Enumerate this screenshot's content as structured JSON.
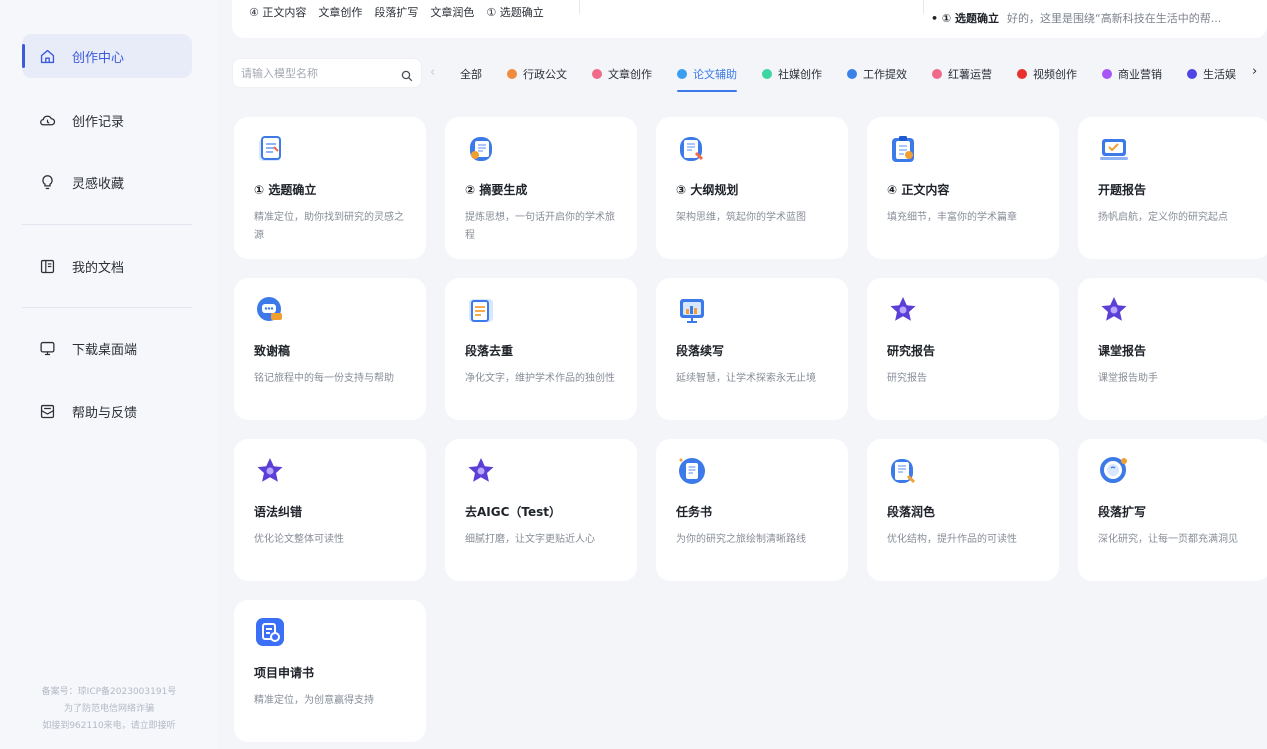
{
  "sidebar": {
    "items": [
      {
        "label": "创作中心",
        "icon": "home-icon",
        "active": true
      },
      {
        "label": "创作记录",
        "icon": "cloud-history-icon"
      },
      {
        "label": "灵感收藏",
        "icon": "lightbulb-icon"
      },
      {
        "label": "我的文档",
        "icon": "document-book-icon"
      },
      {
        "label": "下载桌面端",
        "icon": "monitor-icon"
      },
      {
        "label": "帮助与反馈",
        "icon": "feedback-mail-icon"
      }
    ],
    "footer": [
      "备案号：琼ICP备2023003191号",
      "为了防范电信网络诈骗",
      "如接到962110来电，请立即接听"
    ]
  },
  "top": {
    "recent": [
      "④ 正文内容",
      "文章创作",
      "段落扩写",
      "文章润色",
      "① 选题确立"
    ],
    "notice_title": "• ① 选题确立",
    "notice_text": "好的，这里是围绕“高新科技在生活中的帮..."
  },
  "search": {
    "placeholder": "请输入模型名称"
  },
  "categories": [
    {
      "label": "全部",
      "color": ""
    },
    {
      "label": "行政公文",
      "color": "#f08a3c"
    },
    {
      "label": "文章创作",
      "color": "#f06b8a"
    },
    {
      "label": "论文辅助",
      "color": "#3b9ef0",
      "active": true
    },
    {
      "label": "社媒创作",
      "color": "#3dd6a0"
    },
    {
      "label": "工作提效",
      "color": "#3b82e8"
    },
    {
      "label": "红薯运营",
      "color": "#f06b8a"
    },
    {
      "label": "视频创作",
      "color": "#e8302e"
    },
    {
      "label": "商业营销",
      "color": "#a855f7"
    },
    {
      "label": "生活娱",
      "color": "#4f46e5"
    }
  ],
  "cards": [
    {
      "title": "① 选题确立",
      "desc": "精准定位，助你找到研究的灵感之源",
      "icon": "notebook-list-icon"
    },
    {
      "title": "② 摘要生成",
      "desc": "提炼思想，一句话开启你的学术旅程",
      "icon": "document-shield-icon"
    },
    {
      "title": "③ 大纲规划",
      "desc": "架构思维，筑起你的学术蓝图",
      "icon": "document-pen-icon"
    },
    {
      "title": "④ 正文内容",
      "desc": "填充细节，丰富你的学术篇章",
      "icon": "clipboard-list-icon"
    },
    {
      "title": "开题报告",
      "desc": "扬帆启航，定义你的研究起点",
      "icon": "laptop-check-icon"
    },
    {
      "title": "致谢稿",
      "desc": "铭记旅程中的每一份支持与帮助",
      "icon": "chat-bubble-icon"
    },
    {
      "title": "段落去重",
      "desc": "净化文字，维护学术作品的独创性",
      "icon": "document-arrows-icon"
    },
    {
      "title": "段落续写",
      "desc": "延续智慧，让学术探索永无止境",
      "icon": "presentation-board-icon"
    },
    {
      "title": "研究报告",
      "desc": "研究报告",
      "icon": "star-icon"
    },
    {
      "title": "课堂报告",
      "desc": "课堂报告助手",
      "icon": "star-icon"
    },
    {
      "title": "语法纠错",
      "desc": "优化论文整体可读性",
      "icon": "star-icon"
    },
    {
      "title": "去AIGC（Test）",
      "desc": "细腻打磨，让文字更贴近人心",
      "icon": "star-icon"
    },
    {
      "title": "任务书",
      "desc": "为你的研究之旅绘制清晰路线",
      "icon": "document-circle-icon"
    },
    {
      "title": "段落润色",
      "desc": "优化结构，提升作品的可读性",
      "icon": "document-brush-icon"
    },
    {
      "title": "段落扩写",
      "desc": "深化研究，让每一页都充满洞见",
      "icon": "magnifier-icon"
    },
    {
      "title": "项目申请书",
      "desc": "精准定位，为创意赢得支持",
      "icon": "application-form-icon"
    }
  ]
}
